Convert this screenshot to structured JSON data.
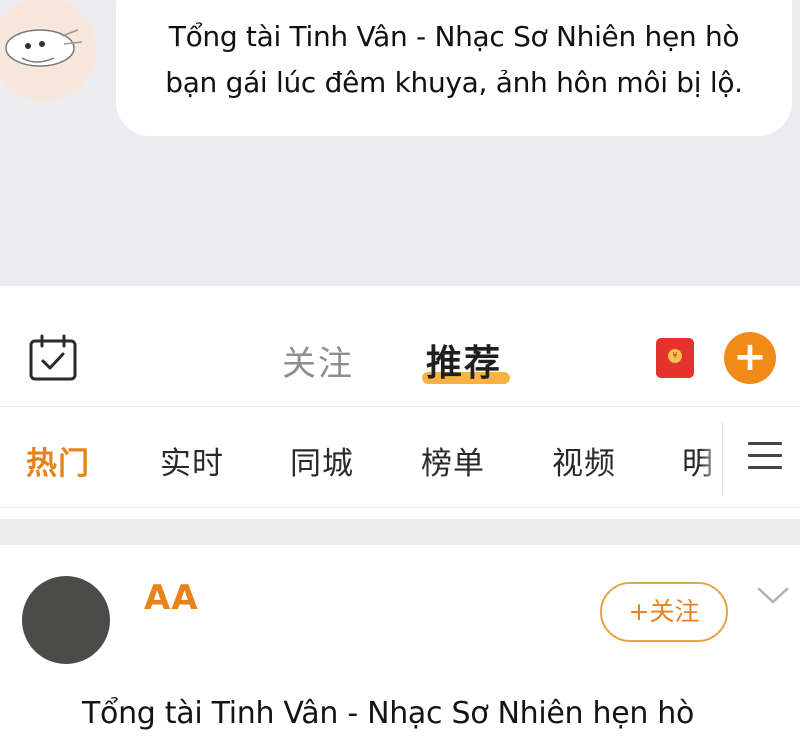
{
  "chat": {
    "bubble_line1": "Tổng tài Tinh Vân - Nhạc Sơ Nhiên hẹn hò",
    "bubble_line2": "bạn gái lúc đêm khuya, ảnh hôn môi bị lộ."
  },
  "header": {
    "tab_follow": "关注",
    "tab_recommend": "推荐",
    "active_tab": "推荐",
    "add_label": "+",
    "accent_color": "#f08a18"
  },
  "channels": {
    "items": [
      "热门",
      "实时",
      "同城",
      "榜单",
      "视频",
      "明"
    ],
    "active": "热门"
  },
  "post": {
    "author": "AA",
    "follow_label": "+关注",
    "text": "Tổng tài Tinh Vân - Nhạc Sơ Nhiên hẹn hò"
  },
  "icons": {
    "calendar": "calendar-check-icon",
    "red_packet": "red-packet-icon",
    "menu": "hamburger-menu-icon",
    "chevron": "chevron-down-icon"
  }
}
